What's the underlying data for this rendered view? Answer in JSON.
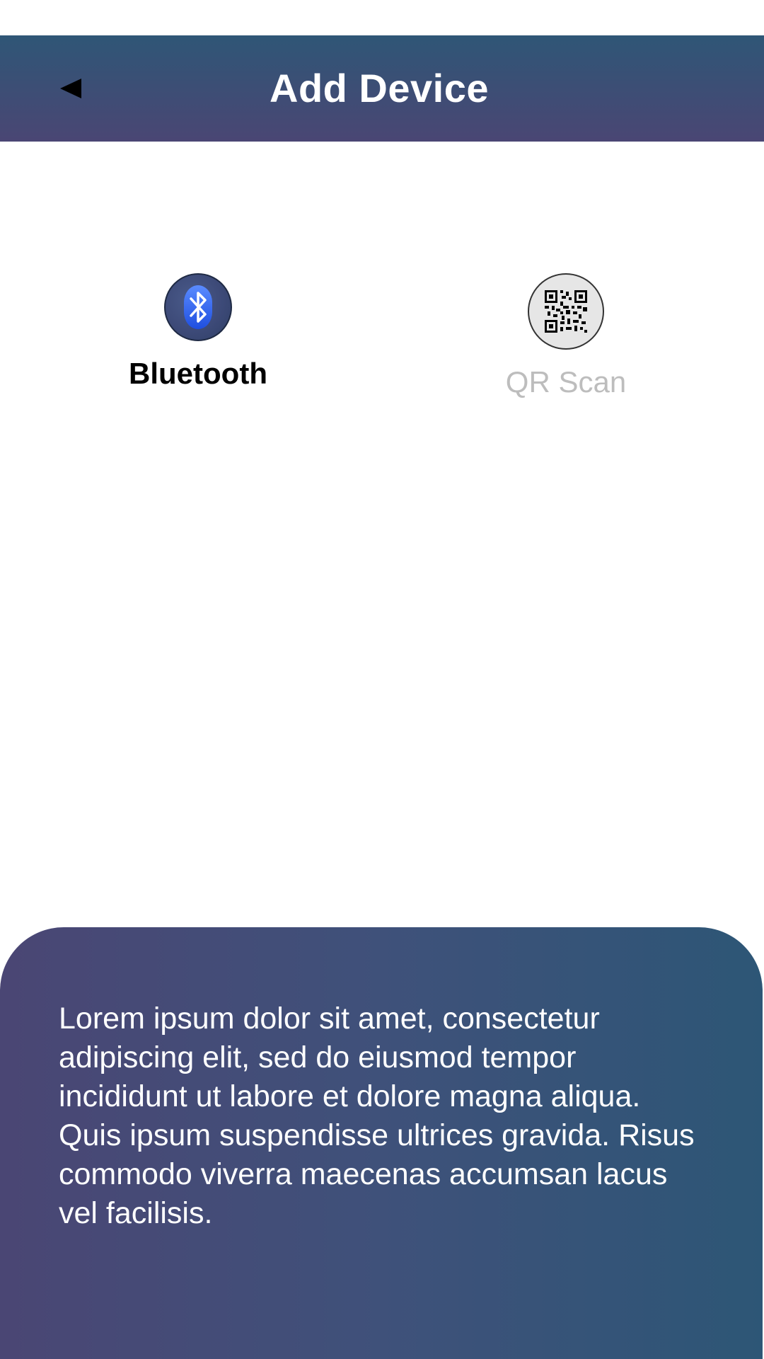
{
  "header": {
    "title": "Add Device",
    "back_icon": "back-arrow-icon"
  },
  "options": [
    {
      "label": "Bluetooth",
      "icon": "bluetooth-icon",
      "selected": true
    },
    {
      "label": "QR Scan",
      "icon": "qr-code-icon",
      "selected": false
    }
  ],
  "info": {
    "text": "Lorem ipsum dolor sit amet, consectetur adipiscing elit, sed do eiusmod tempor incididunt ut labore et dolore magna aliqua. Quis ipsum suspendisse ultrices gravida. Risus commodo viverra maecenas accumsan lacus vel facilisis."
  },
  "colors": {
    "header_gradient_top": "#2f5676",
    "header_gradient_bottom": "#4a4674",
    "panel_gradient_left": "#4a4674",
    "panel_gradient_right": "#2d5676",
    "inactive_label": "#bdbdbd"
  }
}
